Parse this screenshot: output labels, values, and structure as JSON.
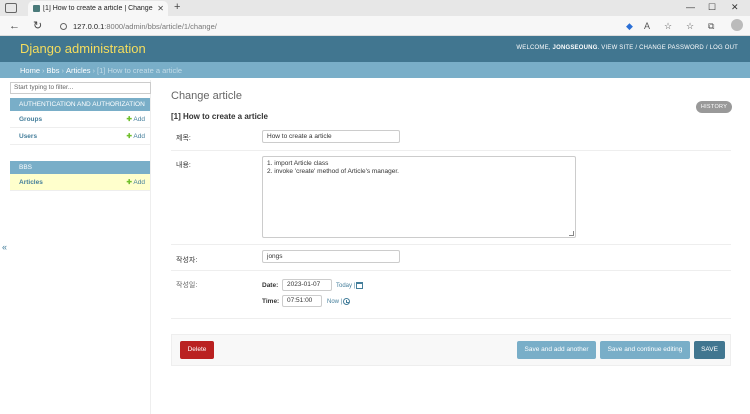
{
  "browser": {
    "tab_title": "[1] How to create a article | Change",
    "tab_close": "✕",
    "new_tab": "+",
    "url_host": "127.0.0.1",
    "url_path": ":8000/admin/bbs/article/1/change/",
    "icons": [
      "back-icon",
      "forward-icon",
      "reload-icon",
      "info-icon",
      "tracking-icon",
      "read-aloud-icon",
      "favorite-icon",
      "favorites-icon",
      "collections-icon",
      "profile-icon"
    ]
  },
  "header": {
    "brand": "Django administration",
    "welcome": "WELCOME,",
    "username": "JONGSEOUNG",
    "view_site": "VIEW SITE",
    "change_password": "CHANGE PASSWORD",
    "log_out": "LOG OUT",
    "sep": "/"
  },
  "breadcrumbs": {
    "home": "Home",
    "app": "Bbs",
    "model": "Articles",
    "current": "[1] How to create a article",
    "sep": "›"
  },
  "sidebar": {
    "filter_placeholder": "Start typing to filter...",
    "collapse": "«",
    "modules": [
      {
        "caption": "Authentication and Authorization",
        "models": [
          {
            "name": "Groups",
            "add": "Add"
          },
          {
            "name": "Users",
            "add": "Add"
          }
        ]
      },
      {
        "caption": "BBS",
        "models": [
          {
            "name": "Articles",
            "add": "Add",
            "active": true
          }
        ]
      }
    ]
  },
  "content": {
    "page_title": "Change article",
    "history": "HISTORY",
    "object_title": "[1] How to create a article",
    "fields": {
      "title_label": "제목:",
      "title_value": "How to create a article",
      "content_label": "내용:",
      "content_line1": "1. import Article class",
      "content_line2": "2. invoke 'create' method of Article's manager.",
      "author_label": "작성자:",
      "author_value": "jongs",
      "created_label": "작성일:",
      "date_label": "Date:",
      "date_value": "2023-01-07",
      "today": "Today",
      "time_label": "Time:",
      "time_value": "07:51:00",
      "now": "Now",
      "shortcut_sep": "|"
    },
    "buttons": {
      "delete": "Delete",
      "save_add": "Save and add another",
      "save_continue": "Save and continue editing",
      "save": "SAVE"
    }
  },
  "colors": {
    "header": "#417690",
    "brand": "#f5dd5d",
    "breadcrumbs": "#79aec8",
    "delete": "#ba2121",
    "active_row": "#ffffcc"
  }
}
